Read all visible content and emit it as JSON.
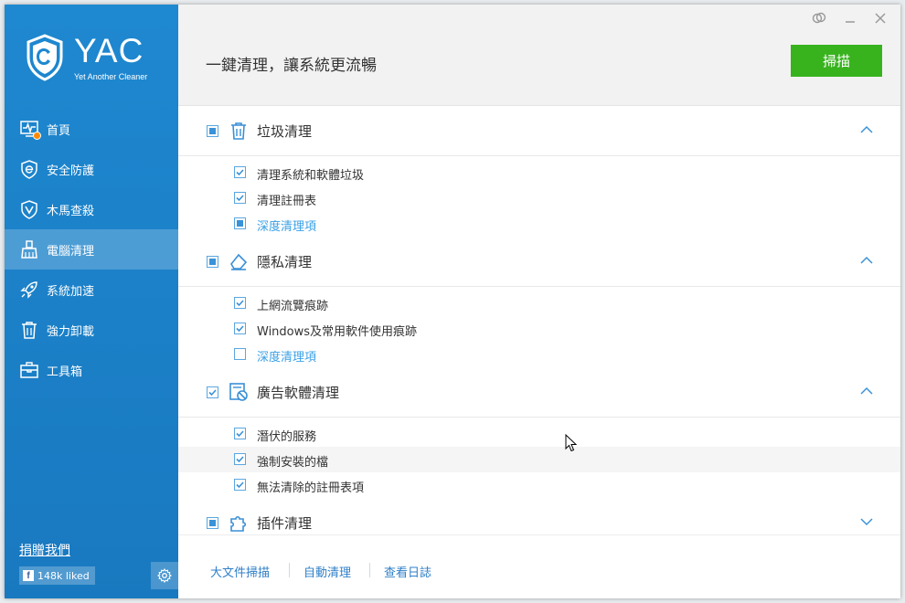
{
  "app": {
    "logo_text": "YAC",
    "logo_subtitle": "Yet Another Cleaner"
  },
  "sidebar": {
    "items": [
      {
        "label": "首頁",
        "icon": "pulse-monitor-icon"
      },
      {
        "label": "安全防護",
        "icon": "shield-e-icon"
      },
      {
        "label": "木馬查殺",
        "icon": "shield-check-icon"
      },
      {
        "label": "電腦清理",
        "icon": "broom-icon",
        "active": true
      },
      {
        "label": "系統加速",
        "icon": "rocket-icon"
      },
      {
        "label": "強力卸載",
        "icon": "trash-icon"
      },
      {
        "label": "工具箱",
        "icon": "toolbox-icon"
      }
    ],
    "donate_label": "捐贈我們",
    "facebook_label": "148k liked",
    "settings_icon": "gear-icon"
  },
  "header": {
    "title": "一鍵清理，讓系統更流暢",
    "scan_label": "掃描"
  },
  "sections": [
    {
      "title": "垃圾清理",
      "icon": "trash-icon",
      "state": "partial",
      "expanded": true,
      "items": [
        {
          "label": "清理系統和軟體垃圾",
          "state": "checked"
        },
        {
          "label": "清理註冊表",
          "state": "checked"
        },
        {
          "label": "深度清理項",
          "state": "partial",
          "link": true
        }
      ]
    },
    {
      "title": "隱私清理",
      "icon": "eraser-icon",
      "state": "partial",
      "expanded": true,
      "items": [
        {
          "label": "上網流覽痕跡",
          "state": "checked"
        },
        {
          "label": "Windows及常用軟件使用痕跡",
          "state": "checked"
        },
        {
          "label": "深度清理項",
          "state": "unchecked",
          "link": true
        }
      ]
    },
    {
      "title": "廣告軟體清理",
      "icon": "ad-block-icon",
      "state": "checked",
      "expanded": true,
      "items": [
        {
          "label": "潛伏的服務",
          "state": "checked"
        },
        {
          "label": "強制安裝的檔",
          "state": "checked"
        },
        {
          "label": "無法清除的註冊表項",
          "state": "checked"
        }
      ]
    },
    {
      "title": "插件清理",
      "icon": "puzzle-icon",
      "state": "partial",
      "expanded": false,
      "items": []
    }
  ],
  "footer": {
    "links": [
      "大文件掃描",
      "自動清理",
      "查看日誌"
    ]
  },
  "colors": {
    "sidebar": "#1e88d0",
    "scan_button": "#38b31e",
    "accent": "#3a92d8",
    "link": "#2f7fc8"
  }
}
